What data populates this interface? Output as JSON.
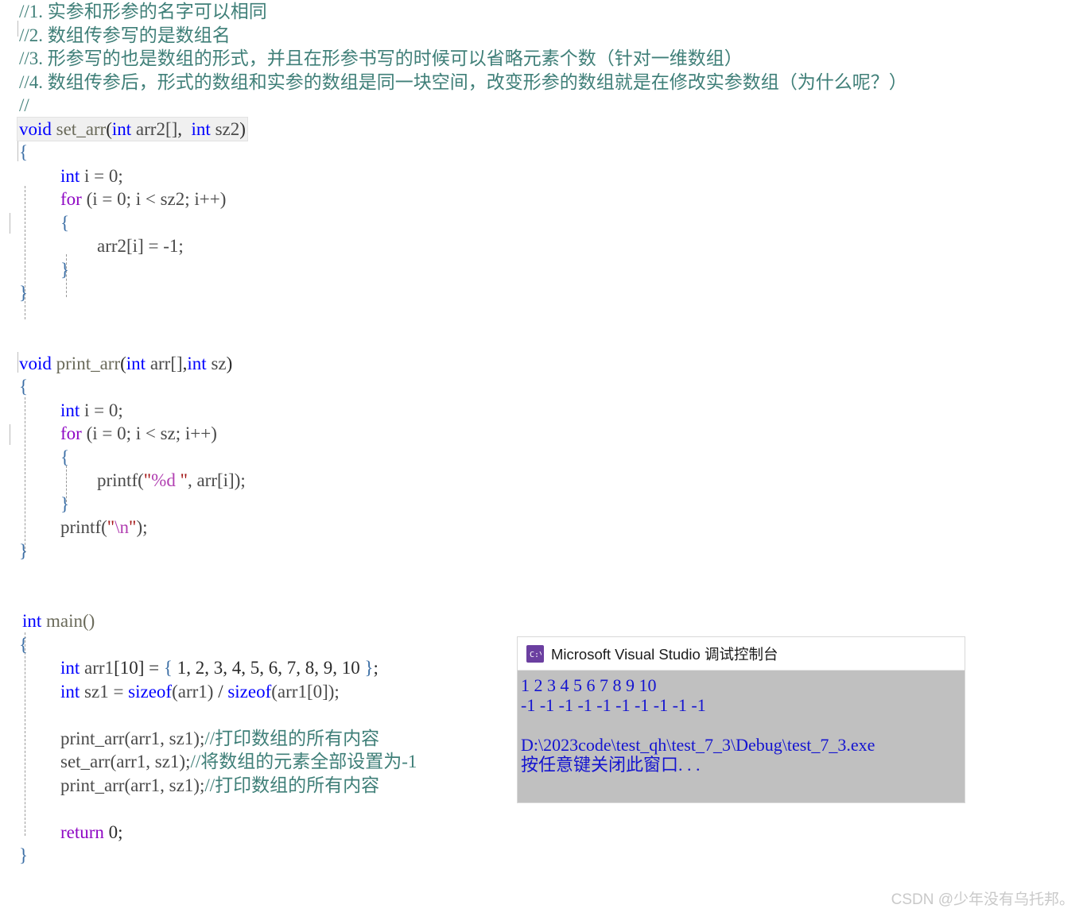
{
  "editor": {
    "comments_header": [
      "//1. 实参和形参的名字可以相同",
      "//2. 数组传参写的是数组名",
      "//3. 形参写的也是数组的形式，并且在形参书写的时候可以省略元素个数（针对一维数组）",
      "//4. 数组传参后，形式的数组和实参的数组是同一块空间，改变形参的数组就是在修改实参数组（为什么呢？）",
      "//"
    ],
    "set_arr": {
      "sig_kw_void": "void",
      "sig_name": " set_arr",
      "sig_open": "(",
      "sig_kw_int1": "int",
      "sig_arg1": " arr2[]",
      "sig_comma": ",  ",
      "sig_kw_int2": "int",
      "sig_arg2": " sz2",
      "sig_close": ")",
      "brace_open": "{",
      "decl_kw": "int",
      "decl_rest": " i = 0;",
      "for_kw": "for",
      "for_rest": " (i = 0; i < sz2; i++)",
      "inner_brace_open": "{",
      "body_stmt": "arr2[i] = -1;",
      "inner_brace_close": "}",
      "brace_close": "}"
    },
    "print_arr": {
      "sig_kw_void": "void",
      "sig_name": " print_arr",
      "sig_open": "(",
      "sig_kw_int1": "int",
      "sig_arg1": " arr[]",
      "sig_comma": ",",
      "sig_kw_int2": "int",
      "sig_arg2": " sz",
      "sig_close": ")",
      "brace_open": "{",
      "decl_kw": "int",
      "decl_rest": " i = 0;",
      "for_kw": "for",
      "for_rest": " (i = 0; i < sz; i++)",
      "inner_brace_open": "{",
      "printf_name": "printf(",
      "printf_q1": "\"",
      "printf_fmt": "%d",
      "printf_q2": " \"",
      "printf_tail": ", arr[i]);",
      "inner_brace_close": "}",
      "printf2_name": "printf(",
      "printf2_q1": "\"",
      "printf2_esc": "\\n",
      "printf2_q2": "\"",
      "printf2_tail": ");",
      "brace_close": "}"
    },
    "main": {
      "sig_kw_int": "int",
      "sig_name": " main()",
      "brace_open": "{",
      "arr_kw": "int",
      "arr_name": " arr1",
      "arr_dim_open": "[",
      "arr_dim": "10",
      "arr_dim_close": "]",
      "arr_eq": " = ",
      "arr_brace_open": "{",
      "arr_values": " 1, 2, 3, 4, 5, 6, 7, 8, 9, 10 ",
      "arr_brace_close": "}",
      "arr_semi": ";",
      "sz_kw": "int",
      "sz_name": " sz1 = ",
      "sz_sizeof1": "sizeof",
      "sz_arg1": "(arr1)",
      "sz_div": " / ",
      "sz_sizeof2": "sizeof",
      "sz_arg2": "(arr1[0]);",
      "call1_code": "print_arr(arr1, sz1);",
      "call1_comment": "//打印数组的所有内容",
      "call2_code": "set_arr(arr1, sz1);",
      "call2_comment": "//将数组的元素全部设置为-1",
      "call3_code": "print_arr(arr1, sz1);",
      "call3_comment": "//打印数组的所有内容",
      "return_kw": "return",
      "return_rest": " 0;",
      "brace_close": "}"
    }
  },
  "console": {
    "icon_name": "command-prompt-icon",
    "title": "Microsoft Visual Studio 调试控制台",
    "lines": [
      "1 2 3 4 5 6 7 8 9 10",
      "-1 -1 -1 -1 -1 -1 -1 -1 -1 -1",
      "",
      "D:\\2023code\\test_qh\\test_7_3\\Debug\\test_7_3.exe",
      "按任意键关闭此窗口. . ."
    ]
  },
  "watermark": {
    "text": "CSDN @少年没有乌托邦。"
  },
  "colors": {
    "keyword_blue": "#0000ff",
    "keyword_purple": "#8f08c4",
    "comment_teal": "#3f7f78",
    "string_red": "#a31515",
    "escape_magenta": "#b13fb1",
    "console_text_blue": "#1414d0",
    "console_bg": "#c0c0c0",
    "watermark_gray": "#c9c9c9"
  }
}
